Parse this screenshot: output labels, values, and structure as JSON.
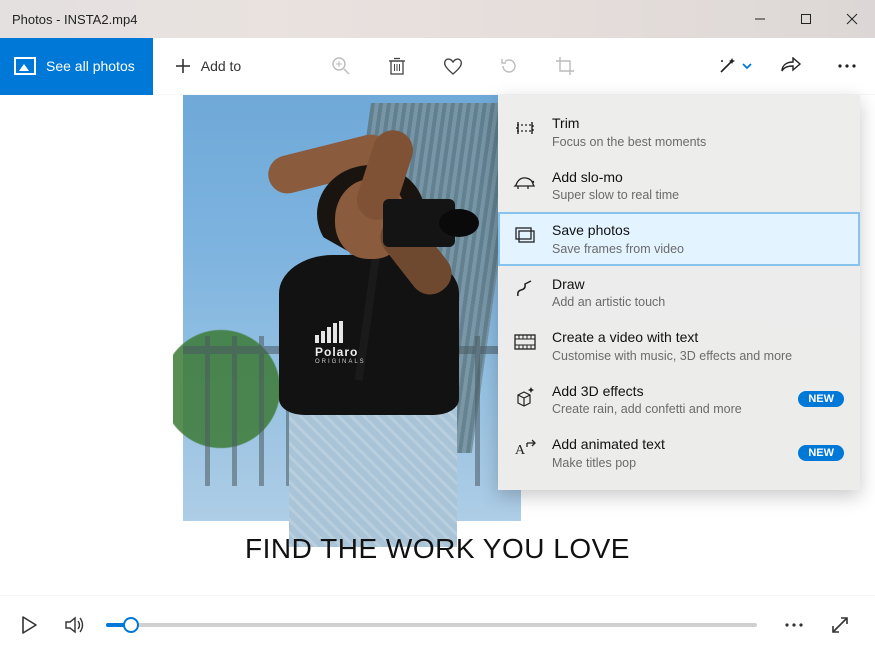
{
  "titlebar": {
    "title": "Photos - INSTA2.mp4"
  },
  "toolbar": {
    "see_all_label": "See all photos",
    "add_to_label": "Add to"
  },
  "caption": "FIND THE WORK YOU LOVE",
  "shirt": {
    "brand": "Polaro",
    "sub": "ORIGINALS"
  },
  "dropdown": {
    "items": [
      {
        "title": "Trim",
        "sub": "Focus on the best moments"
      },
      {
        "title": "Add slo-mo",
        "sub": "Super slow to real time"
      },
      {
        "title": "Save photos",
        "sub": "Save frames from video"
      },
      {
        "title": "Draw",
        "sub": "Add an artistic touch"
      },
      {
        "title": "Create a video with text",
        "sub": "Customise with music, 3D effects and more"
      },
      {
        "title": "Add 3D effects",
        "sub": "Create rain, add confetti and more",
        "badge": "NEW"
      },
      {
        "title": "Add animated text",
        "sub": "Make titles pop",
        "badge": "NEW"
      }
    ]
  },
  "colors": {
    "accent": "#0078d7"
  }
}
